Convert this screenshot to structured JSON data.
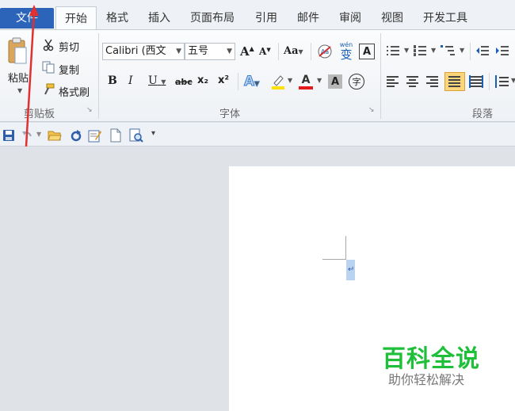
{
  "tabs": {
    "file": "文件",
    "home": "开始",
    "format": "格式",
    "insert": "插入",
    "layout": "页面布局",
    "references": "引用",
    "mailings": "邮件",
    "review": "审阅",
    "view": "视图",
    "developer": "开发工具"
  },
  "clipboard": {
    "paste": "粘贴",
    "cut": "剪切",
    "copy": "复制",
    "format_painter": "格式刷",
    "group_label": "剪贴板"
  },
  "font": {
    "font_name": "Calibri (西文",
    "font_size": "五号",
    "grow": "A",
    "shrink": "A",
    "case": "Aa",
    "bold": "B",
    "italic": "I",
    "underline": "U",
    "strike": "abc",
    "subscript": "x₂",
    "superscript": "x²",
    "effects": "A",
    "color": "A",
    "shade": "A",
    "phonetic": "wén",
    "enclose": "字",
    "group_label": "字体"
  },
  "paragraph": {
    "group_label": "段落"
  },
  "watermark": {
    "title": "百科全说",
    "subtitle": "助你轻松解决"
  },
  "colors": {
    "accent": "#2b64b8",
    "highlight": "#ffe000",
    "font_color": "#e31a1a",
    "watermark": "#1fbf3a",
    "arrow": "#e03030"
  },
  "icons": [
    "scissors-icon",
    "copy-icon",
    "format-painter-icon",
    "paste-icon",
    "save-icon",
    "undo-icon",
    "open-icon",
    "redo-icon",
    "edit-icon",
    "new-doc-icon",
    "print-preview-icon",
    "bullets-icon",
    "numbering-icon",
    "multilevel-icon",
    "decrease-indent-icon",
    "increase-indent-icon",
    "align-left-icon",
    "align-center-icon",
    "align-right-icon",
    "justify-icon",
    "distributed-icon",
    "line-spacing-icon"
  ]
}
